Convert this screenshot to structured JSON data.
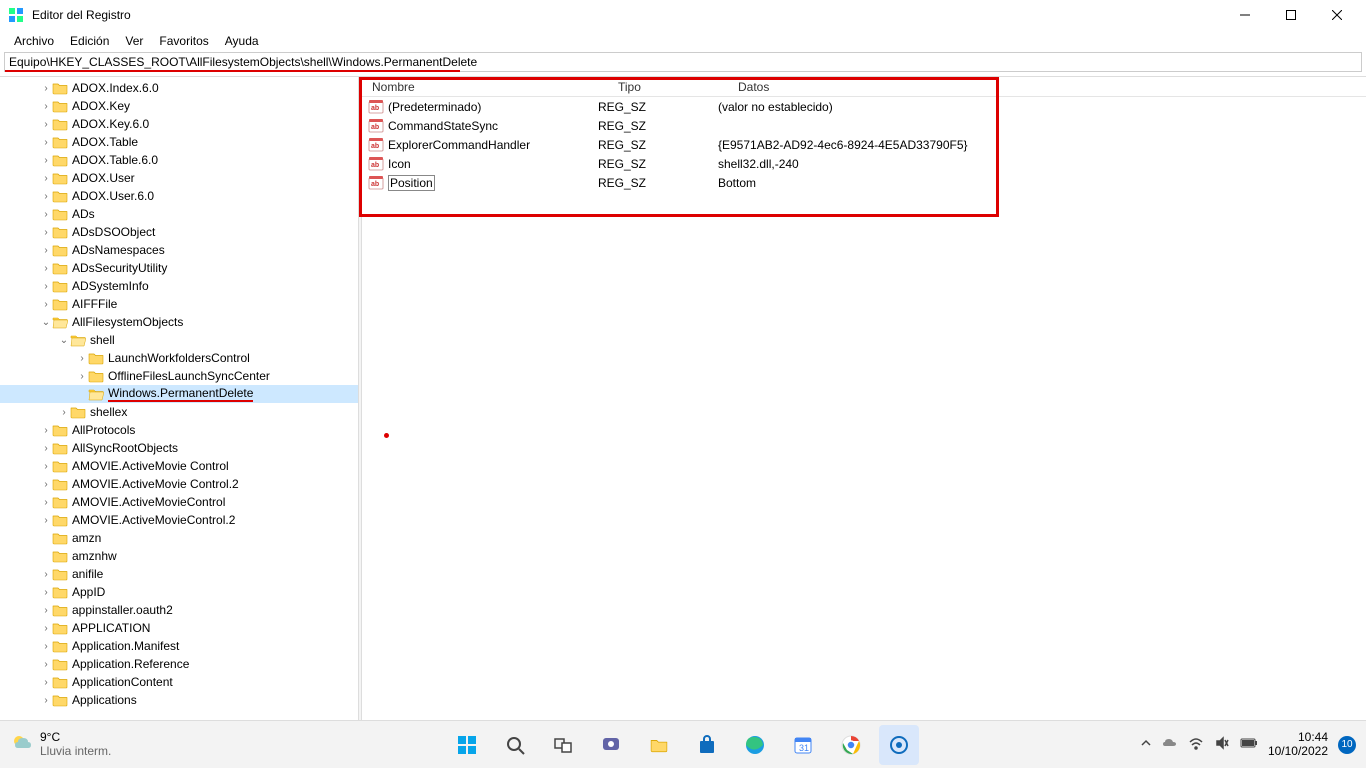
{
  "window": {
    "title": "Editor del Registro"
  },
  "menu": {
    "items": [
      "Archivo",
      "Edición",
      "Ver",
      "Favoritos",
      "Ayuda"
    ]
  },
  "address": {
    "path": "Equipo\\HKEY_CLASSES_ROOT\\AllFilesystemObjects\\shell\\Windows.PermanentDelete"
  },
  "tree": [
    {
      "indent": 2,
      "caret": ">",
      "label": "ADOX.Index.6.0"
    },
    {
      "indent": 2,
      "caret": ">",
      "label": "ADOX.Key"
    },
    {
      "indent": 2,
      "caret": ">",
      "label": "ADOX.Key.6.0"
    },
    {
      "indent": 2,
      "caret": ">",
      "label": "ADOX.Table"
    },
    {
      "indent": 2,
      "caret": ">",
      "label": "ADOX.Table.6.0"
    },
    {
      "indent": 2,
      "caret": ">",
      "label": "ADOX.User"
    },
    {
      "indent": 2,
      "caret": ">",
      "label": "ADOX.User.6.0"
    },
    {
      "indent": 2,
      "caret": ">",
      "label": "ADs"
    },
    {
      "indent": 2,
      "caret": ">",
      "label": "ADsDSOObject"
    },
    {
      "indent": 2,
      "caret": ">",
      "label": "ADsNamespaces"
    },
    {
      "indent": 2,
      "caret": ">",
      "label": "ADsSecurityUtility"
    },
    {
      "indent": 2,
      "caret": ">",
      "label": "ADSystemInfo"
    },
    {
      "indent": 2,
      "caret": ">",
      "label": "AIFFFile"
    },
    {
      "indent": 2,
      "caret": "v",
      "label": "AllFilesystemObjects"
    },
    {
      "indent": 3,
      "caret": "v",
      "label": "shell"
    },
    {
      "indent": 4,
      "caret": ">",
      "label": "LaunchWorkfoldersControl"
    },
    {
      "indent": 4,
      "caret": ">",
      "label": "OfflineFilesLaunchSyncCenter"
    },
    {
      "indent": 4,
      "caret": "",
      "label": "Windows.PermanentDelete",
      "selected": true,
      "underline": true
    },
    {
      "indent": 3,
      "caret": ">",
      "label": "shellex"
    },
    {
      "indent": 2,
      "caret": ">",
      "label": "AllProtocols"
    },
    {
      "indent": 2,
      "caret": ">",
      "label": "AllSyncRootObjects"
    },
    {
      "indent": 2,
      "caret": ">",
      "label": "AMOVIE.ActiveMovie Control"
    },
    {
      "indent": 2,
      "caret": ">",
      "label": "AMOVIE.ActiveMovie Control.2"
    },
    {
      "indent": 2,
      "caret": ">",
      "label": "AMOVIE.ActiveMovieControl"
    },
    {
      "indent": 2,
      "caret": ">",
      "label": "AMOVIE.ActiveMovieControl.2"
    },
    {
      "indent": 2,
      "caret": "",
      "label": "amzn"
    },
    {
      "indent": 2,
      "caret": "",
      "label": "amznhw"
    },
    {
      "indent": 2,
      "caret": ">",
      "label": "anifile"
    },
    {
      "indent": 2,
      "caret": ">",
      "label": "AppID"
    },
    {
      "indent": 2,
      "caret": ">",
      "label": "appinstaller.oauth2"
    },
    {
      "indent": 2,
      "caret": ">",
      "label": "APPLICATION"
    },
    {
      "indent": 2,
      "caret": ">",
      "label": "Application.Manifest"
    },
    {
      "indent": 2,
      "caret": ">",
      "label": "Application.Reference"
    },
    {
      "indent": 2,
      "caret": ">",
      "label": "ApplicationContent"
    },
    {
      "indent": 2,
      "caret": ">",
      "label": "Applications"
    }
  ],
  "list": {
    "headers": {
      "name": "Nombre",
      "type": "Tipo",
      "data": "Datos"
    },
    "rows": [
      {
        "name": "(Predeterminado)",
        "type": "REG_SZ",
        "data": "(valor no establecido)"
      },
      {
        "name": "CommandStateSync",
        "type": "REG_SZ",
        "data": ""
      },
      {
        "name": "ExplorerCommandHandler",
        "type": "REG_SZ",
        "data": "{E9571AB2-AD92-4ec6-8924-4E5AD33790F5}"
      },
      {
        "name": "Icon",
        "type": "REG_SZ",
        "data": "shell32.dll,-240"
      },
      {
        "name": "Position",
        "type": "REG_SZ",
        "data": "Bottom",
        "selected": true
      }
    ]
  },
  "taskbar": {
    "weather": {
      "temp": "9°C",
      "desc": "Lluvia interm."
    },
    "time": "10:44",
    "date": "10/10/2022",
    "notif": "10"
  }
}
